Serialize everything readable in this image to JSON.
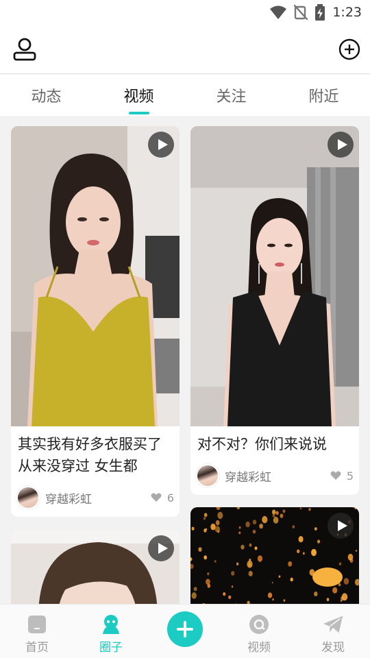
{
  "status_bar": {
    "time": "1:23"
  },
  "tabs": [
    {
      "label": "动态",
      "active": false
    },
    {
      "label": "视频",
      "active": true
    },
    {
      "label": "关注",
      "active": false
    },
    {
      "label": "附近",
      "active": false
    }
  ],
  "cards": [
    {
      "title": "其实我有好多衣服买了从来没穿过 女生都",
      "author": "穿越彩虹",
      "likes": "6"
    },
    {
      "title": "对不对？你们来说说",
      "author": "穿越彩虹",
      "likes": "5"
    },
    {
      "title": "",
      "author": "",
      "likes": ""
    },
    {
      "title": "",
      "author": "",
      "likes": ""
    }
  ],
  "bottom_nav": [
    {
      "label": "首页",
      "icon": "home-icon",
      "active": false
    },
    {
      "label": "圈子",
      "icon": "circle-icon",
      "active": true
    },
    {
      "label": "",
      "icon": "plus-icon",
      "active": false
    },
    {
      "label": "视频",
      "icon": "video-icon",
      "active": false
    },
    {
      "label": "发现",
      "icon": "discover-icon",
      "active": false
    }
  ],
  "colors": {
    "accent": "#1ccbc1",
    "background": "#f2f2f2",
    "tab_inactive": "#666666"
  }
}
